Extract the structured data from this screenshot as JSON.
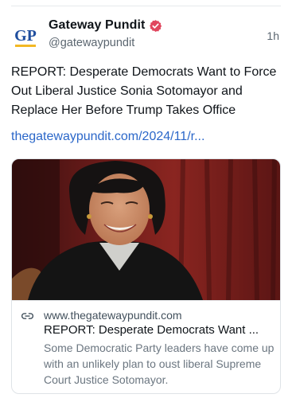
{
  "post": {
    "author": {
      "display_name": "Gateway Pundit",
      "handle": "@gatewaypundit",
      "avatar_text": "GP",
      "verified": true
    },
    "timestamp": "1h",
    "text": "REPORT: Desperate Democrats Want to Force Out Liberal Justice Sonia Sotomayor and Replace Her Before Trump Takes Office",
    "link_text": "thegatewaypundit.com/2024/11/r...",
    "card": {
      "domain": "www.thegatewaypundit.com",
      "title": "REPORT: Desperate Democrats Want ...",
      "description": "Some Democratic Party leaders have come up with an unlikely plan to oust liberal Supreme Court Justice Sotomayor."
    }
  },
  "colors": {
    "link": "#2b67c9",
    "verified_badge": "#e0465e",
    "avatar_blue": "#1f4e9e",
    "avatar_gold": "#f2b824"
  },
  "icons": {
    "verified": "verified-badge-icon",
    "link": "link-icon"
  }
}
